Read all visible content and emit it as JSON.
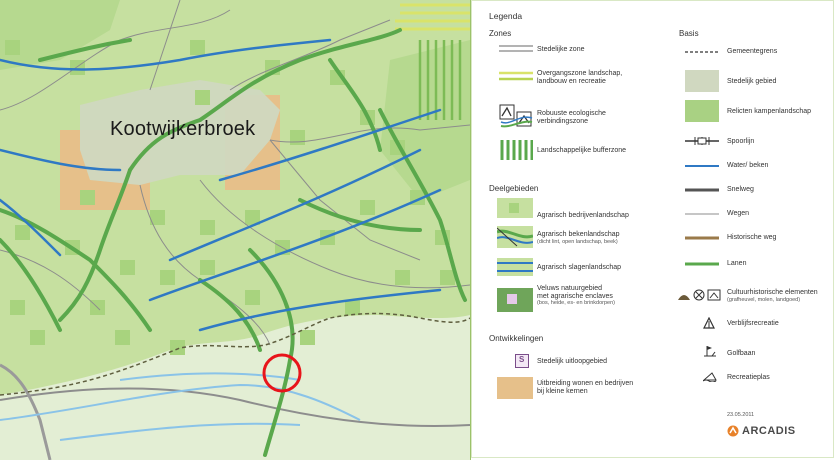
{
  "map": {
    "town_label": "Kootwijkerbroek",
    "colors": {
      "base": "#c6e0a0",
      "relic": "#a9d183",
      "lower": "#e3eed4",
      "urban": "#d0d8c0",
      "expansion": "#e6c08a",
      "green_line": "#5aa84c",
      "blue_line": "#2f79c4",
      "water": "#8ac3e8",
      "road": "#8c8c8c",
      "highlight": "#e8141a"
    }
  },
  "legend": {
    "title": "Legenda",
    "zones": {
      "heading": "Zones",
      "items": [
        {
          "label": "Stedelijke zone",
          "sub": ""
        },
        {
          "label": "Overgangszone landschap,",
          "sub": "landbouw en recreatie"
        },
        {
          "label": "Robuuste ecologische",
          "sub": "verbindingszone"
        },
        {
          "label": "Landschappelijke bufferzone",
          "sub": ""
        }
      ]
    },
    "deelgebieden": {
      "heading": "Deelgebieden",
      "items": [
        {
          "label": "Agrarisch bedrijvenlandschap",
          "sub": ""
        },
        {
          "label": "Agrarisch bekenlandschap",
          "sub": "(dicht lint, open landschap, beek)"
        },
        {
          "label": "Agrarisch slagenlandschap",
          "sub": ""
        },
        {
          "label": "Veluws natuurgebied",
          "sub": "met agrarische enclaves",
          "sub2": "(bos, heide, es- en brinkdorpen)"
        }
      ]
    },
    "ontwikkelingen": {
      "heading": "Ontwikkelingen",
      "items": [
        {
          "label": "Stedelijk uitloopgebied",
          "sub": ""
        },
        {
          "label": "Uitbreiding wonen en bedrijven",
          "sub": "bij kleine kernen"
        }
      ]
    },
    "basis": {
      "heading": "Basis",
      "items": [
        {
          "label": "Gemeentegrens",
          "sub": ""
        },
        {
          "label": "Stedelijk gebied",
          "sub": ""
        },
        {
          "label": "Relicten kampenlandschap",
          "sub": ""
        },
        {
          "label": "Spoorlijn",
          "sub": ""
        },
        {
          "label": "Water/ beken",
          "sub": ""
        },
        {
          "label": "Snelweg",
          "sub": ""
        },
        {
          "label": "Wegen",
          "sub": ""
        },
        {
          "label": "Historische weg",
          "sub": ""
        },
        {
          "label": "Lanen",
          "sub": ""
        },
        {
          "label": "Cultuurhistorische elementen",
          "sub": "(grafheuvel, molen, landgoed)"
        },
        {
          "label": "Verblijfsrecreatie",
          "sub": ""
        },
        {
          "label": "Golfbaan",
          "sub": ""
        },
        {
          "label": "Recreatieplas",
          "sub": ""
        }
      ]
    },
    "date": "23.05.2011",
    "logo_text": "ARCADIS",
    "s_symbol": "S"
  }
}
